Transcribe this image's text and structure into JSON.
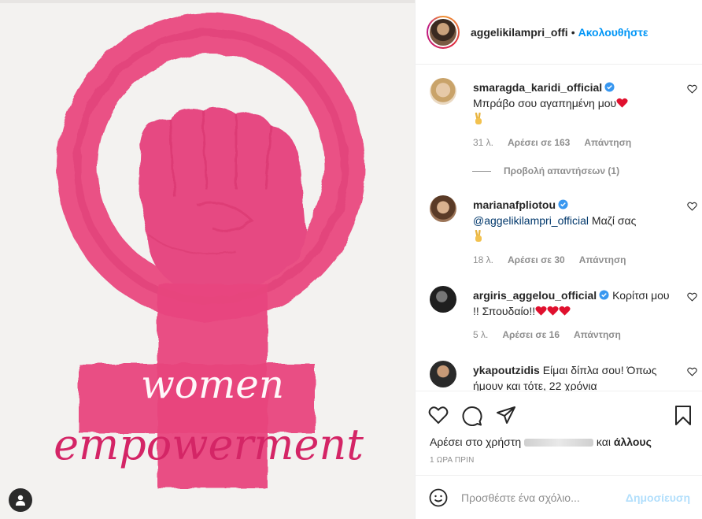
{
  "post_image": {
    "line1": "women",
    "line2": "empowerment",
    "colors": {
      "pink": "#e83f7a",
      "dark_pink": "#c91f5e",
      "bg": "#f3f2f0"
    }
  },
  "header": {
    "username": "aggelikilampri_offi",
    "separator": "•",
    "follow_label": "Ακολουθήστε"
  },
  "comments": [
    {
      "username": "smaragda_karidi_official",
      "verified": true,
      "text": "Μπράβο σου αγαπημένη μου",
      "age": "31 λ.",
      "likes": "Αρέσει σε 163",
      "reply": "Απάντηση"
    },
    {
      "username": "marianafpliotou",
      "verified": true,
      "mention": "@aggelikilampri_official",
      "text": "Μαζί σας",
      "age": "18 λ.",
      "likes": "Αρέσει σε 30",
      "reply": "Απάντηση"
    },
    {
      "username": "argiris_aggelou_official",
      "verified": true,
      "text": "Κορίτσι μου !! Σπουδαίο!!",
      "age": "5 λ.",
      "likes": "Αρέσει σε 16",
      "reply": "Απάντηση"
    },
    {
      "username": "ykapoutzidis",
      "verified": false,
      "text": "Είμαι δίπλα σου! Όπως ήμουν και τότε, 22 χρόνια"
    }
  ],
  "view_replies": "Προβολή απαντήσεων (1)",
  "actions": {
    "likes_prefix": "Αρέσει στο χρήστη",
    "likes_suffix": "και",
    "likes_others": "άλλους",
    "timestamp": "1 ΩΡΑ ΠΡΙΝ"
  },
  "add_comment": {
    "placeholder": "Προσθέστε ένα σχόλιο...",
    "post_label": "Δημοσίευση"
  },
  "icons": [
    "user-icon",
    "verified-icon",
    "heart-icon",
    "comment-icon",
    "share-icon",
    "bookmark-icon",
    "emoji-icon"
  ],
  "accent_color": "#0095f6"
}
